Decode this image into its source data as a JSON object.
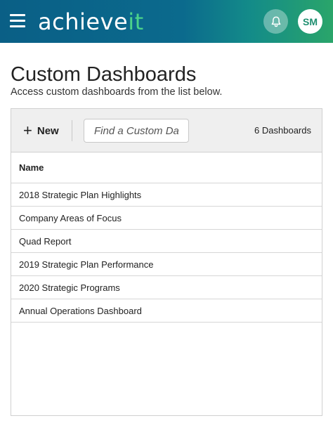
{
  "header": {
    "logo_main": "achieve",
    "logo_accent": "it",
    "avatar_initials": "SM"
  },
  "page": {
    "title": "Custom Dashboards",
    "subtitle": "Access custom dashboards from the list below."
  },
  "toolbar": {
    "new_label": "New",
    "search_placeholder": "Find a Custom Da",
    "count_text": "6 Dashboards"
  },
  "table": {
    "column_name": "Name",
    "rows": [
      "2018 Strategic Plan Highlights",
      "Company Areas of Focus",
      "Quad Report",
      "2019 Strategic Plan Performance",
      "2020 Strategic Programs",
      "Annual Operations Dashboard"
    ]
  },
  "colors": {
    "header_start": "#0a5f86",
    "header_end": "#2aa56a",
    "logo_accent": "#4cd38a"
  },
  "icons": [
    "hamburger-icon",
    "bell-icon",
    "plus-icon"
  ]
}
